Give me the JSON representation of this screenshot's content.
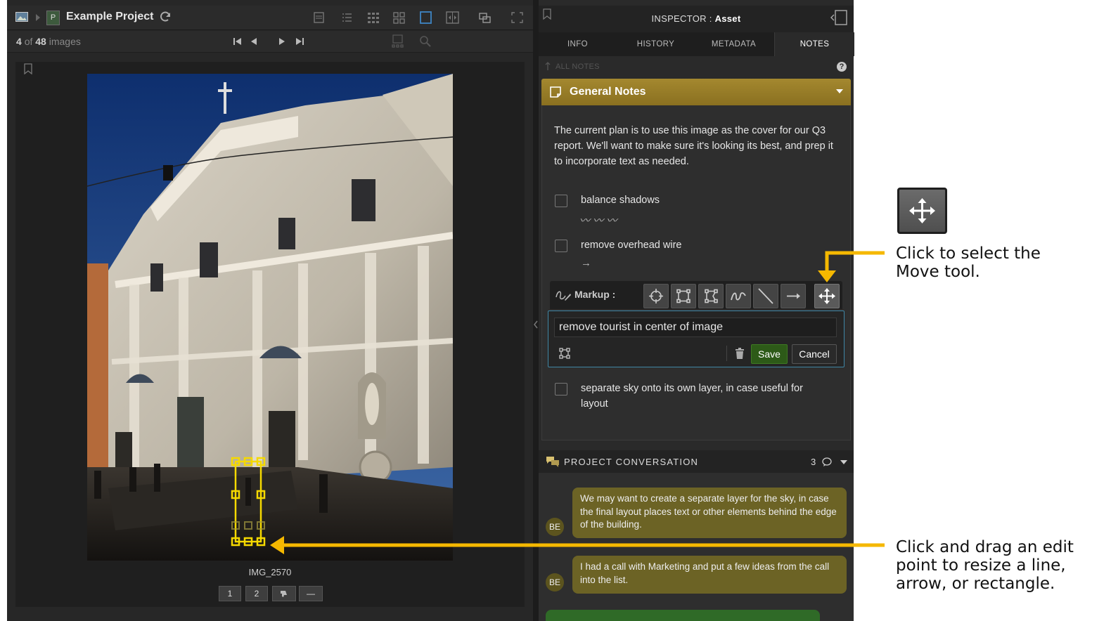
{
  "viewer": {
    "project_title": "Example Project",
    "project_badge": "P",
    "count_current": "4",
    "count_of": "of",
    "count_total": "48",
    "count_suffix": "images",
    "image_caption": "IMG_2570",
    "pills": [
      "1",
      "2",
      "",
      "—"
    ]
  },
  "inspector": {
    "title_prefix": "INSPECTOR : ",
    "title_name": "Asset",
    "tabs": [
      "INFO",
      "HISTORY",
      "METADATA",
      "NOTES"
    ],
    "active_tab": "NOTES",
    "all_notes": "ALL NOTES",
    "help": "?"
  },
  "notes": {
    "header": "General Notes",
    "description": "The current plan is to use this image as the cover for our Q3 report. We'll want to make sure it's looking its best, and prep it to incorporate text as needed.",
    "tasks": [
      {
        "label": "balance shadows",
        "markup": "〰 〰 〰"
      },
      {
        "label": "remove overhead wire",
        "markup": "→"
      },
      {
        "label": "separate sky onto its own layer, in case useful for layout",
        "markup": ""
      }
    ],
    "markup_label": "Markup :",
    "edit_value": "remove tourist in center of image",
    "save": "Save",
    "cancel": "Cancel"
  },
  "conversation": {
    "header": "PROJECT CONVERSATION",
    "count": "3",
    "messages": [
      {
        "avatar": "BE",
        "text": "We may want to create a separate layer for the sky, in case the final layout places text or other elements behind the edge of the building."
      },
      {
        "avatar": "BE",
        "text": "I had a call with Marketing and put a few ideas from the call into the list."
      }
    ]
  },
  "callouts": {
    "move_tool": "Click to select the Move tool.",
    "edit_point": "Click and drag an edit point to resize a line, arrow, or rectangle."
  },
  "colors": {
    "notes_header": "#9a7e28",
    "callout_arrow": "#f5b800",
    "edit_border": "#3f86a5",
    "save_button": "#2d5a18",
    "chat_bubble": "#6c6325"
  }
}
